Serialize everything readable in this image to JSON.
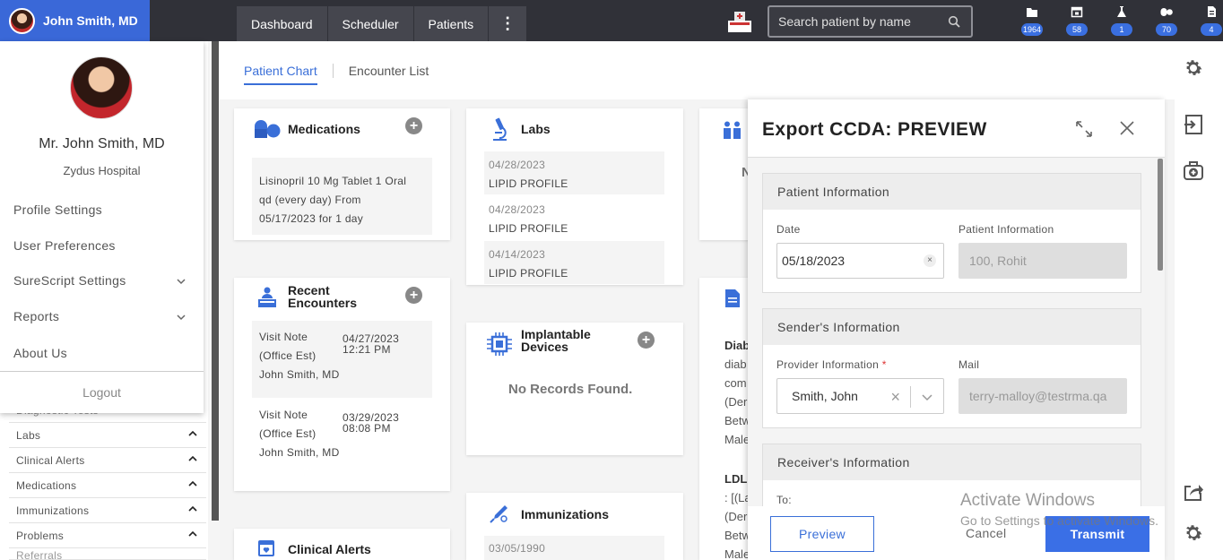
{
  "header": {
    "user_name": "John Smith, MD",
    "nav_tabs": [
      "Dashboard",
      "Scheduler",
      "Patients"
    ],
    "more_label": "⋮",
    "search_placeholder": "Search patient by name",
    "stats": [
      {
        "icon": "folder-icon",
        "count": "1964"
      },
      {
        "icon": "calendar-icon",
        "count": "58"
      },
      {
        "icon": "flask-icon",
        "count": "1"
      },
      {
        "icon": "pills-icon",
        "count": "70"
      },
      {
        "icon": "document-icon",
        "count": "4"
      }
    ]
  },
  "profile_menu": {
    "name": "Mr. John Smith, MD",
    "organization": "Zydus Hospital",
    "items": [
      "Profile Settings",
      "User Preferences",
      "SureScript Settings",
      "Reports",
      "About Us"
    ],
    "logout": "Logout"
  },
  "sidebar": {
    "rows": [
      "Diagnostic Tests",
      "Labs",
      "Clinical Alerts",
      "Medications",
      "Immunizations",
      "Problems",
      "Referrals"
    ]
  },
  "subtabs": {
    "active": "Patient Chart",
    "other": "Encounter List"
  },
  "cards": {
    "medications": {
      "title": "Medications",
      "items": [
        {
          "line1": "Lisinopril 10 Mg Tablet 1 Oral",
          "line2": "qd (every day) From",
          "line3": "05/17/2023 for 1 day"
        }
      ]
    },
    "labs": {
      "title": "Labs",
      "items": [
        {
          "date": "04/28/2023",
          "name": "LIPID PROFILE"
        },
        {
          "date": "04/28/2023",
          "name": "LIPID PROFILE"
        },
        {
          "date": "04/14/2023",
          "name": "LIPID PROFILE"
        }
      ]
    },
    "recent_encounters": {
      "title_line1": "Recent",
      "title_line2": "Encounters",
      "items": [
        {
          "line1": "Visit Note",
          "line2": "(Office Est)",
          "provider": "John Smith, MD",
          "date": "04/27/2023",
          "time": "12:21 PM"
        },
        {
          "line1": "Visit Note",
          "line2": "(Office Est)",
          "provider": "John Smith, MD",
          "date": "03/29/2023",
          "time": "08:08 PM"
        }
      ]
    },
    "implantable_devices": {
      "title_line1": "Implantable",
      "title_line2": "Devices",
      "empty_text": "No Records Found."
    },
    "immunizations": {
      "title": "Immunizations",
      "items": [
        {
          "date": "03/05/1990"
        }
      ]
    },
    "clinical_alerts": {
      "title": "Clinical Alerts"
    },
    "partial_card_1": {
      "text": "N"
    },
    "partial_card_2": {
      "lines": [
        "Diab",
        "diab",
        "com",
        "(Der",
        "Betw",
        "Male"
      ],
      "lines2": [
        "LDL",
        ": [(La",
        "(Der",
        "Betw",
        "Male"
      ]
    }
  },
  "modal": {
    "title": "Export CCDA: PREVIEW",
    "patient_section": {
      "heading": "Patient Information",
      "date_label": "Date",
      "date_value": "05/18/2023",
      "patient_label": "Patient Information",
      "patient_value": "100, Rohit"
    },
    "sender_section": {
      "heading": "Sender's Information",
      "provider_label": "Provider Information",
      "required_mark": "*",
      "provider_value": "Smith, John",
      "mail_label": "Mail",
      "mail_value": "terry-malloy@testrma.qa"
    },
    "receiver_section": {
      "heading": "Receiver's Information",
      "to_label": "To:"
    },
    "buttons": {
      "preview": "Preview",
      "cancel": "Cancel",
      "transmit": "Transmit"
    }
  },
  "watermark": {
    "line1": "Activate Windows",
    "line2": "Go to Settings to activate Windows."
  },
  "colors": {
    "topbar": "#303138",
    "accent": "#3a68d8",
    "badge": "#3a6fe0"
  }
}
